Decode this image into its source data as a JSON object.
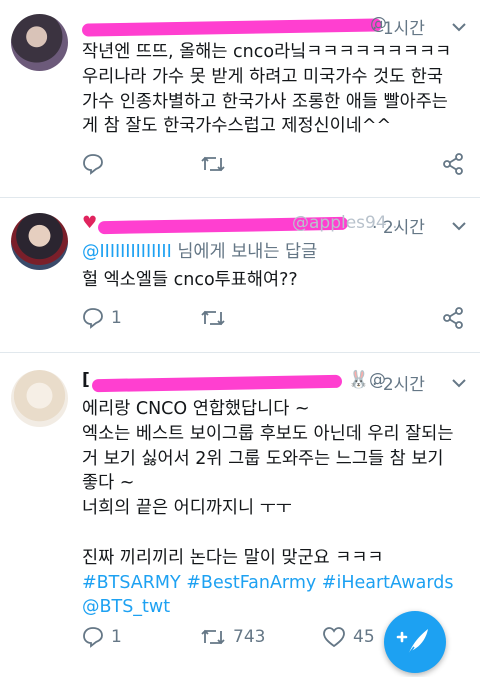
{
  "tweets": [
    {
      "handle_visible": "@",
      "time": "1시간",
      "lines": [
        "작년엔 뜨뜨, 올해는 cnco라닠ㅋㅋㅋㅋㅋㅋㅋㅋㅋ",
        "우리나라 가수 못 받게 하려고 미국가수 것도 한국",
        "가수 인종차별하고 한국가사 조롱한 애들 빨아주는",
        "게 참 잘도 한국가수스럽고 제정신이네^^"
      ],
      "reply_count": "",
      "retweet_count": "",
      "like_count": ""
    },
    {
      "handle_visible": "@apples94...",
      "time": "2시간",
      "reply_to_user": "@IIIIIIIIIIIIII",
      "reply_to_suffix": " 님에게 보내는 답글",
      "lines": [
        "헐 엑소엘들 cnco투표해여??"
      ],
      "reply_count": "1",
      "retweet_count": "",
      "like_count": ""
    },
    {
      "handle_visible": "@",
      "time": "2시간",
      "name_prefix": "[",
      "lines": [
        "에리랑 CNCO 연합했답니다 ~",
        "엑소는 베스트 보이그룹 후보도 아닌데 우리 잘되는",
        "거 보기 싫어서 2위 그룹 도와주는 느그들 참 보기",
        "좋다 ~",
        "너희의 끝은 어디까지니 ㅜㅜ",
        "",
        "진짜 끼리끼리 논다는 말이 맞군요 ㅋㅋㅋ"
      ],
      "hashtags": "#BTSARMY #BestFanArmy #iHeartAwards",
      "mention": "@BTS_twt",
      "reply_count": "1",
      "retweet_count": "743",
      "like_count": "45"
    }
  ],
  "colors": {
    "accent": "#1da1f2",
    "muted": "#657786",
    "redaction": "#ff3fd0"
  },
  "icons": [
    "reply-icon",
    "retweet-icon",
    "like-icon",
    "share-icon",
    "chevron-down-icon",
    "compose-icon"
  ]
}
